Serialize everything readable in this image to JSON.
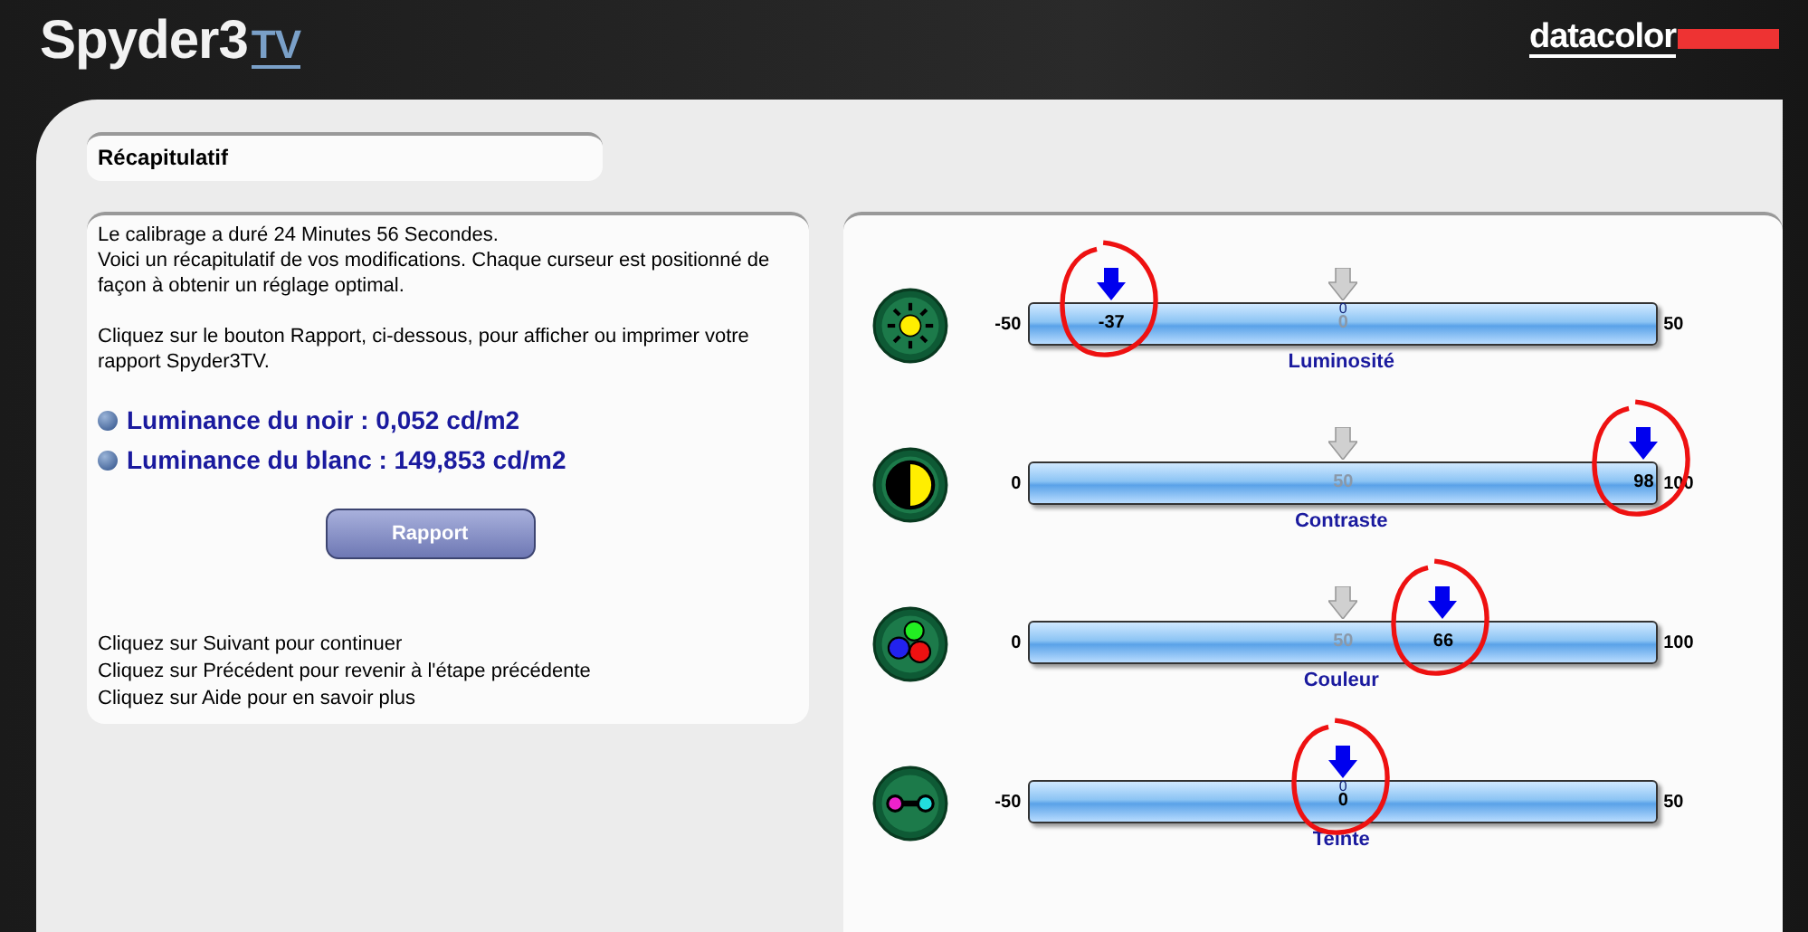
{
  "header": {
    "logo_main": "Spyder3",
    "logo_sub": "TV",
    "brand": "datacolor"
  },
  "title": "Récapitulatif",
  "summary": {
    "paragraphs": [
      "Le calibrage a duré 24 Minutes 56 Secondes.\nVoici un récapitulatif de vos modifications.  Chaque curseur est positionné de façon à obtenir un réglage optimal.",
      "Cliquez sur le bouton Rapport, ci-dessous, pour afficher ou imprimer votre rapport Spyder3TV."
    ],
    "measurements": [
      "Luminance du noir : 0,052 cd/m2",
      "Luminance du blanc : 149,853 cd/m2"
    ],
    "button": "Rapport",
    "instructions": [
      "Cliquez sur Suivant pour continuer",
      "Cliquez sur Précédent pour revenir à l'étape précédente",
      "Cliquez sur Aide pour en savoir plus"
    ]
  },
  "sliders": [
    {
      "kind": "brightness",
      "name": "Luminosité",
      "min": "-50",
      "max": "50",
      "value": "-37",
      "level": 0.13,
      "default_label": "0",
      "center_mark": "0",
      "circled": true
    },
    {
      "kind": "contrast",
      "name": "Contraste",
      "min": "0",
      "max": "100",
      "value": "98",
      "level": 0.98,
      "default_label": "50",
      "circled": true
    },
    {
      "kind": "color",
      "name": "Couleur",
      "min": "0",
      "max": "100",
      "value": "66",
      "level": 0.66,
      "default_label": "50",
      "circled": true
    },
    {
      "kind": "tint",
      "name": "Teinte",
      "min": "-50",
      "max": "50",
      "value": "0",
      "level": 0.5,
      "center_mark": "0",
      "circled": true
    }
  ]
}
